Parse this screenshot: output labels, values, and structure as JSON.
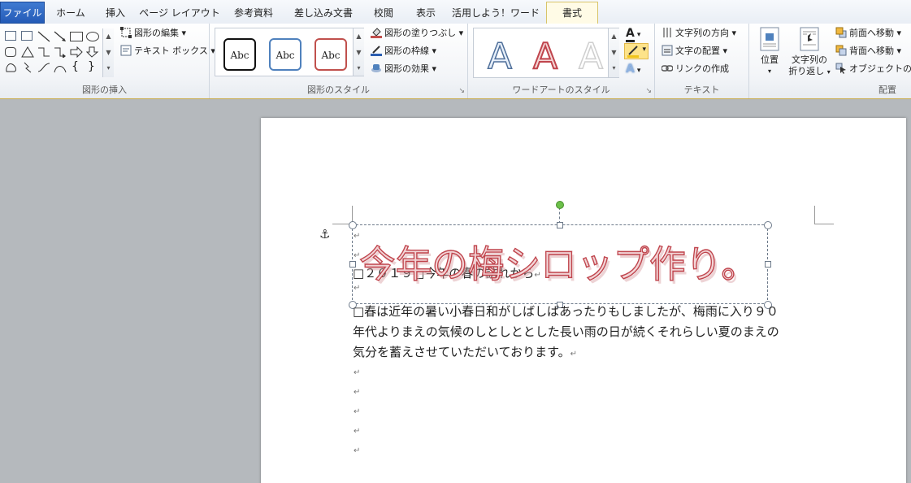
{
  "tabs": [
    {
      "label": "ファイル"
    },
    {
      "label": "ホーム"
    },
    {
      "label": "挿入"
    },
    {
      "label": "ページ レイアウト"
    },
    {
      "label": "参考資料"
    },
    {
      "label": "差し込み文書"
    },
    {
      "label": "校閲"
    },
    {
      "label": "表示"
    },
    {
      "label": "活用しよう！ワード"
    },
    {
      "label": "書式"
    }
  ],
  "ribbon": {
    "insert_shape": {
      "label": "図形の挿入",
      "edit_shape": "図形の編集",
      "text_box": "テキスト ボックス"
    },
    "shape_styles": {
      "label": "図形のスタイル",
      "sample": "Abc",
      "fill": "図形の塗りつぶし",
      "outline": "図形の枠線",
      "effects": "図形の効果"
    },
    "wordart_styles": {
      "label": "ワードアートのスタイル",
      "sample": "A"
    },
    "text": {
      "label": "テキスト",
      "direction": "文字列の方向",
      "align": "文字の配置",
      "link": "リンクの作成"
    },
    "arrange": {
      "label": "配置",
      "position": "位置",
      "wrap_line1": "文字列の",
      "wrap_line2": "折り返し",
      "bring_forward": "前面へ移動",
      "send_backward": "背面へ移動",
      "objects": "オブジェクトの選"
    }
  },
  "document": {
    "wordart_title": "今年の梅シロップ作り。",
    "line1": "□２０１９□今年の春の訪れから",
    "para2_line1": "□春は近年の暑い小春日和がしばしばあったりもしましたが、梅雨に入り９０",
    "para2_line2": "年代よりまえの気候のしとしととした長い雨の日が続くそれらしい夏のまえの",
    "para2_line3": "気分を蓄えさせていただいております。",
    "para_mark": "↵",
    "anchor": "⚓"
  },
  "colors": {
    "accent": "#2a5db0",
    "wordart_fill": "#f2d4d6",
    "wordart_outline": "#c0454d",
    "selection": "#6d7a8a",
    "rotate_handle": "#6cc04a"
  }
}
